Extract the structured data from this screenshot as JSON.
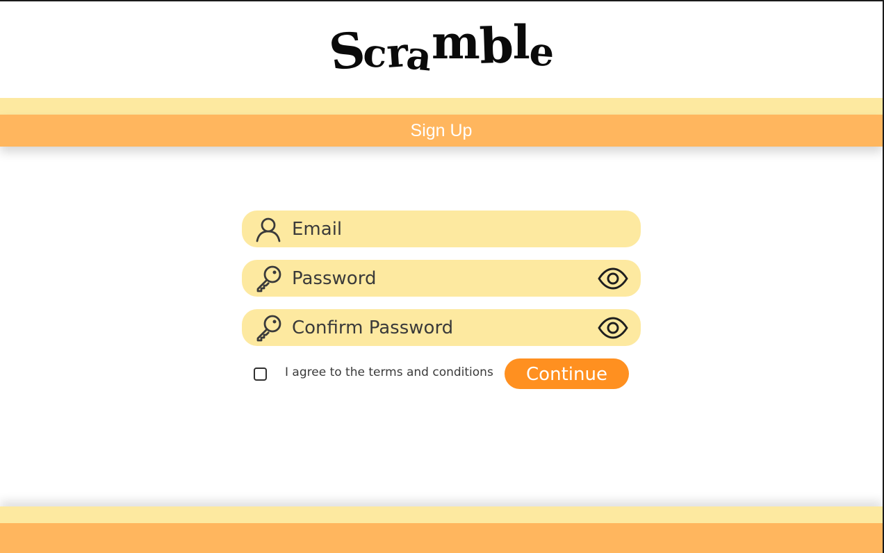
{
  "app": {
    "logo_text": "Scramble"
  },
  "header": {
    "title": "Sign Up"
  },
  "form": {
    "email": {
      "placeholder": "Email",
      "icon": "user-icon"
    },
    "password": {
      "placeholder": "Password",
      "icon": "key-icon",
      "toggle_icon": "eye-icon"
    },
    "confirm_password": {
      "placeholder": "Confirm Password",
      "icon": "key-icon",
      "toggle_icon": "eye-icon"
    },
    "terms": {
      "label": "I agree to the terms and conditions",
      "checked": false
    },
    "continue_label": "Continue"
  },
  "colors": {
    "band_light": "#fde9a0",
    "band_orange": "#ffb65e",
    "field_bg": "#fde9a0",
    "button_bg": "#ff9020",
    "text": "#3a3a3a"
  }
}
